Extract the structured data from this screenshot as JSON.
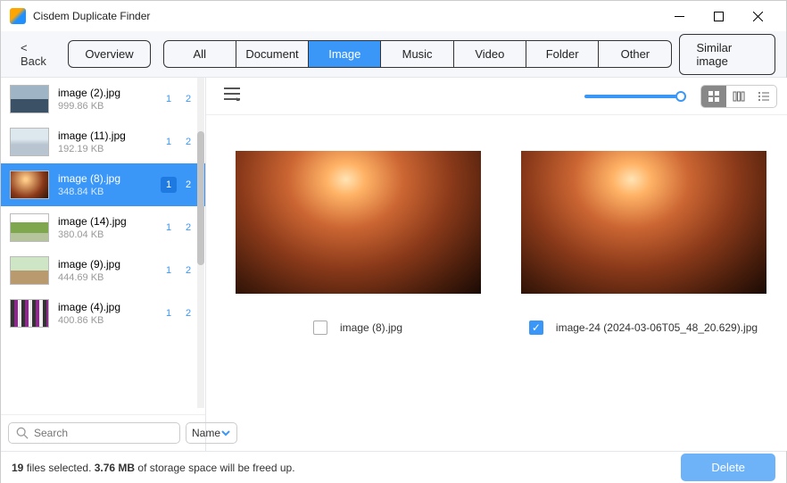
{
  "window": {
    "title": "Cisdem Duplicate Finder"
  },
  "toolbar": {
    "back": "< Back",
    "overview": "Overview",
    "similar": "Similar image",
    "tabs": [
      "All",
      "Document",
      "Image",
      "Music",
      "Video",
      "Folder",
      "Other"
    ],
    "active_tab": 2
  },
  "sidebar": {
    "search_placeholder": "Search",
    "sort_label": "Name",
    "items": [
      {
        "name": "image (2).jpg",
        "size": "999.86 KB",
        "badges": [
          "1",
          "2"
        ]
      },
      {
        "name": "image (11).jpg",
        "size": "192.19 KB",
        "badges": [
          "1",
          "2"
        ]
      },
      {
        "name": "image (8).jpg",
        "size": "348.84 KB",
        "badges": [
          "1",
          "2"
        ]
      },
      {
        "name": "image (14).jpg",
        "size": "380.04 KB",
        "badges": [
          "1",
          "2"
        ]
      },
      {
        "name": "image (9).jpg",
        "size": "444.69 KB",
        "badges": [
          "1",
          "2"
        ]
      },
      {
        "name": "image (4).jpg",
        "size": "400.86 KB",
        "badges": [
          "1",
          "2"
        ]
      }
    ],
    "selected_index": 2
  },
  "preview": {
    "items": [
      {
        "filename": "image (8).jpg",
        "checked": false
      },
      {
        "filename": "image-24 (2024-03-06T05_48_20.629).jpg",
        "checked": true
      }
    ]
  },
  "footer": {
    "count": "19",
    "count_suffix": " files selected.  ",
    "size": "3.76 MB",
    "size_suffix": "  of storage space will be freed up.",
    "delete": "Delete"
  }
}
